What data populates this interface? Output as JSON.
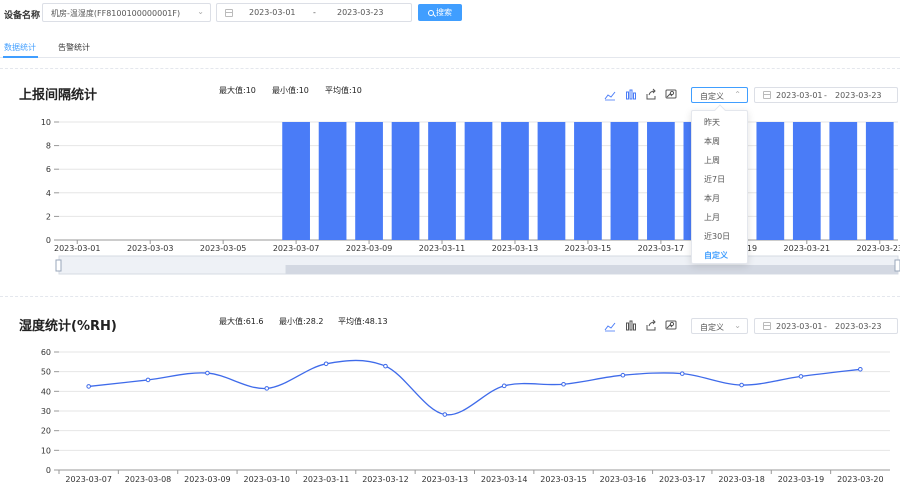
{
  "filter": {
    "device_label": "设备名称",
    "device_value": "机房-温湿度(FF8100100000001F)",
    "date_start": "2023-03-01",
    "date_sep": "-",
    "date_end": "2023-03-23",
    "search_label": "搜索"
  },
  "tabs": [
    {
      "label": "数据统计",
      "active": true
    },
    {
      "label": "告警统计",
      "active": false
    }
  ],
  "panel1": {
    "title": "上报间隔统计",
    "max": "最大值:10",
    "min": "最小值:10",
    "avg": "平均值:10",
    "mode": "自定义",
    "date_start": "2023-03-01",
    "date_sep": "-",
    "date_end": "2023-03-23",
    "tools": [
      "line-chart-icon",
      "bar-chart-icon",
      "share-icon",
      "download-image-icon"
    ]
  },
  "dropdown": {
    "items": [
      "昨天",
      "本周",
      "上周",
      "近7日",
      "本月",
      "上月",
      "近30日",
      "自定义"
    ],
    "selected": "自定义"
  },
  "panel2": {
    "title": "湿度统计(%RH)",
    "max": "最大值:61.6",
    "min": "最小值:28.2",
    "avg": "平均值:48.13",
    "mode": "自定义",
    "date_start": "2023-03-01",
    "date_sep": "-",
    "date_end": "2023-03-23",
    "tools": [
      "line-chart-icon",
      "bar-chart-icon",
      "share-icon",
      "download-image-icon"
    ]
  },
  "colors": {
    "accent": "#409eff",
    "bar": "#4a7cf7",
    "line": "#3f6bea"
  },
  "chart_data": [
    {
      "type": "bar",
      "categories": [
        "2023-03-01",
        "2023-03-02",
        "2023-03-03",
        "2023-03-04",
        "2023-03-05",
        "2023-03-06",
        "2023-03-07",
        "2023-03-08",
        "2023-03-09",
        "2023-03-10",
        "2023-03-11",
        "2023-03-12",
        "2023-03-13",
        "2023-03-14",
        "2023-03-15",
        "2023-03-16",
        "2023-03-17",
        "2023-03-18",
        "2023-03-19",
        "2023-03-20",
        "2023-03-21",
        "2023-03-22",
        "2023-03-23"
      ],
      "tick_labels": [
        "2023-03-01",
        "2023-03-03",
        "2023-03-05",
        "2023-03-07",
        "2023-03-09",
        "2023-03-11",
        "2023-03-13",
        "2023-03-15",
        "2023-03-17",
        "2023-03-19",
        "2023-03-21",
        "2023-03-23"
      ],
      "values": [
        0,
        0,
        0,
        0,
        0,
        0,
        10,
        10,
        10,
        10,
        10,
        10,
        10,
        10,
        10,
        10,
        10,
        10,
        10,
        10,
        10,
        10,
        10
      ],
      "yticks": [
        0,
        2,
        4,
        6,
        8,
        10
      ],
      "ylim": [
        0,
        10
      ],
      "grid": true
    },
    {
      "type": "line",
      "categories": [
        "2023-03-07",
        "2023-03-08",
        "2023-03-09",
        "2023-03-10",
        "2023-03-11",
        "2023-03-12",
        "2023-03-13",
        "2023-03-14",
        "2023-03-15",
        "2023-03-16",
        "2023-03-17",
        "2023-03-18",
        "2023-03-19",
        "2023-03-20"
      ],
      "values": [
        42.5,
        45.8,
        49.3,
        41.5,
        54.0,
        52.8,
        28.2,
        42.8,
        43.6,
        48.2,
        49.0,
        43.2,
        47.6,
        51.2
      ],
      "yticks": [
        0,
        10,
        20,
        30,
        40,
        50,
        60
      ],
      "ylim": [
        0,
        60
      ],
      "grid": true
    }
  ]
}
